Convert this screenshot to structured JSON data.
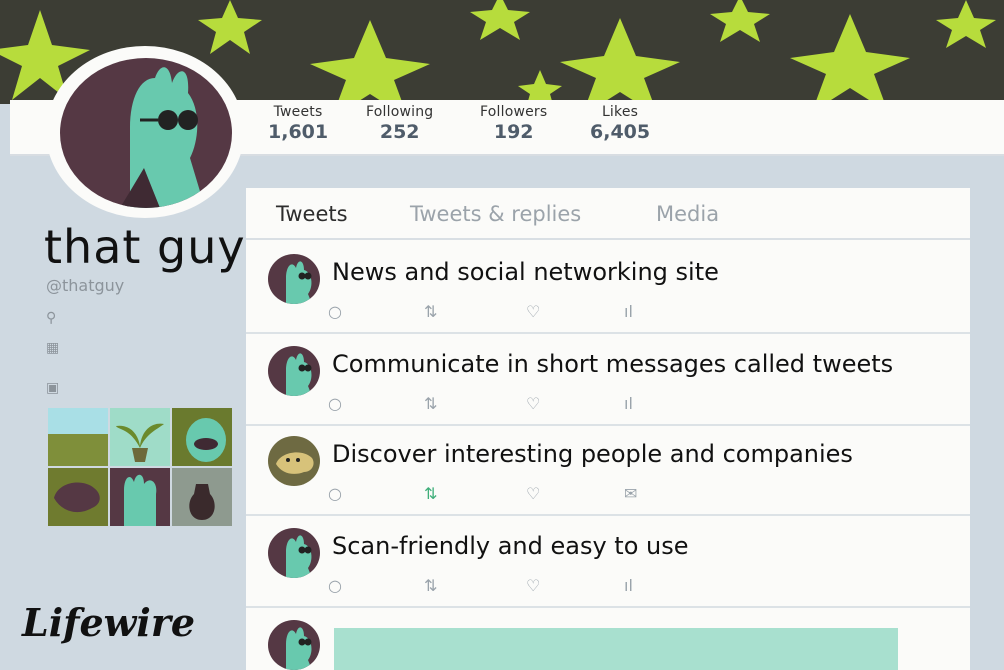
{
  "stats": [
    {
      "label": "Tweets",
      "value": "1,601"
    },
    {
      "label": "Following",
      "value": "252"
    },
    {
      "label": "Followers",
      "value": "192"
    },
    {
      "label": "Likes",
      "value": "6,405"
    }
  ],
  "profile": {
    "name": "that guy",
    "handle": "@thatguy"
  },
  "tabs": [
    "Tweets",
    "Tweets & replies",
    "Media"
  ],
  "tweets": [
    {
      "text": "News and social networking site"
    },
    {
      "text": "Communicate in short messages called tweets"
    },
    {
      "text": "Discover interesting people and companies"
    },
    {
      "text": "Scan-friendly and easy to use"
    }
  ],
  "brand": "Lifewire",
  "icons": {
    "reply": "○",
    "retweet": "⇅",
    "like": "♡",
    "analytics": "ıl",
    "message": "✉",
    "location": "⚲",
    "calendar": "▦",
    "photo": "▣"
  },
  "colors": {
    "banner": "#3c3d34",
    "star": "#b7dc3c",
    "avatar_bg": "#553844",
    "avatar_fg": "#68c9ae",
    "stat_number": "#4f5c6a",
    "page_bg": "#cfd9e1"
  }
}
